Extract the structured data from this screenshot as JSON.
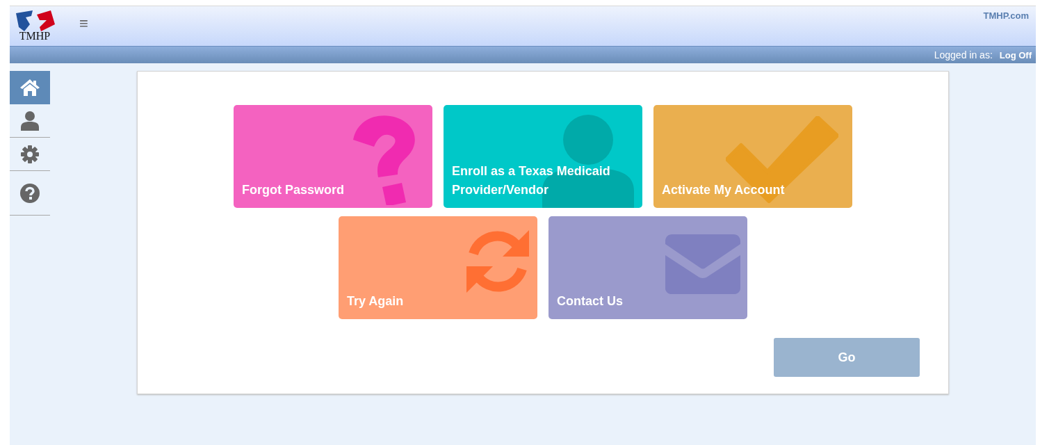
{
  "header": {
    "logo_text": "TMHP",
    "site_link": "TMHP.com",
    "menu_icon": "≡"
  },
  "user_bar": {
    "logged_in_label": "Logged in as:",
    "log_off": "Log Off"
  },
  "sidebar": {
    "items": [
      {
        "kind": "home",
        "selected": true
      },
      {
        "kind": "user",
        "selected": false
      },
      {
        "kind": "settings",
        "selected": false
      },
      {
        "kind": "help",
        "selected": false
      }
    ]
  },
  "tiles": [
    {
      "label": "Forgot Password",
      "kind": "question",
      "color": "#f462c0"
    },
    {
      "label": "Enroll as a Texas Medicaid Provider/Vendor",
      "kind": "person",
      "color": "#00c8c8"
    },
    {
      "label": "Activate My Account",
      "kind": "check",
      "color": "#eaaf4f"
    },
    {
      "label": "Try Again",
      "kind": "refresh",
      "color": "#ff9e73"
    },
    {
      "label": "Contact Us",
      "kind": "mail",
      "color": "#9a9acc"
    }
  ],
  "go_button": {
    "label": "Go",
    "disabled": true
  }
}
